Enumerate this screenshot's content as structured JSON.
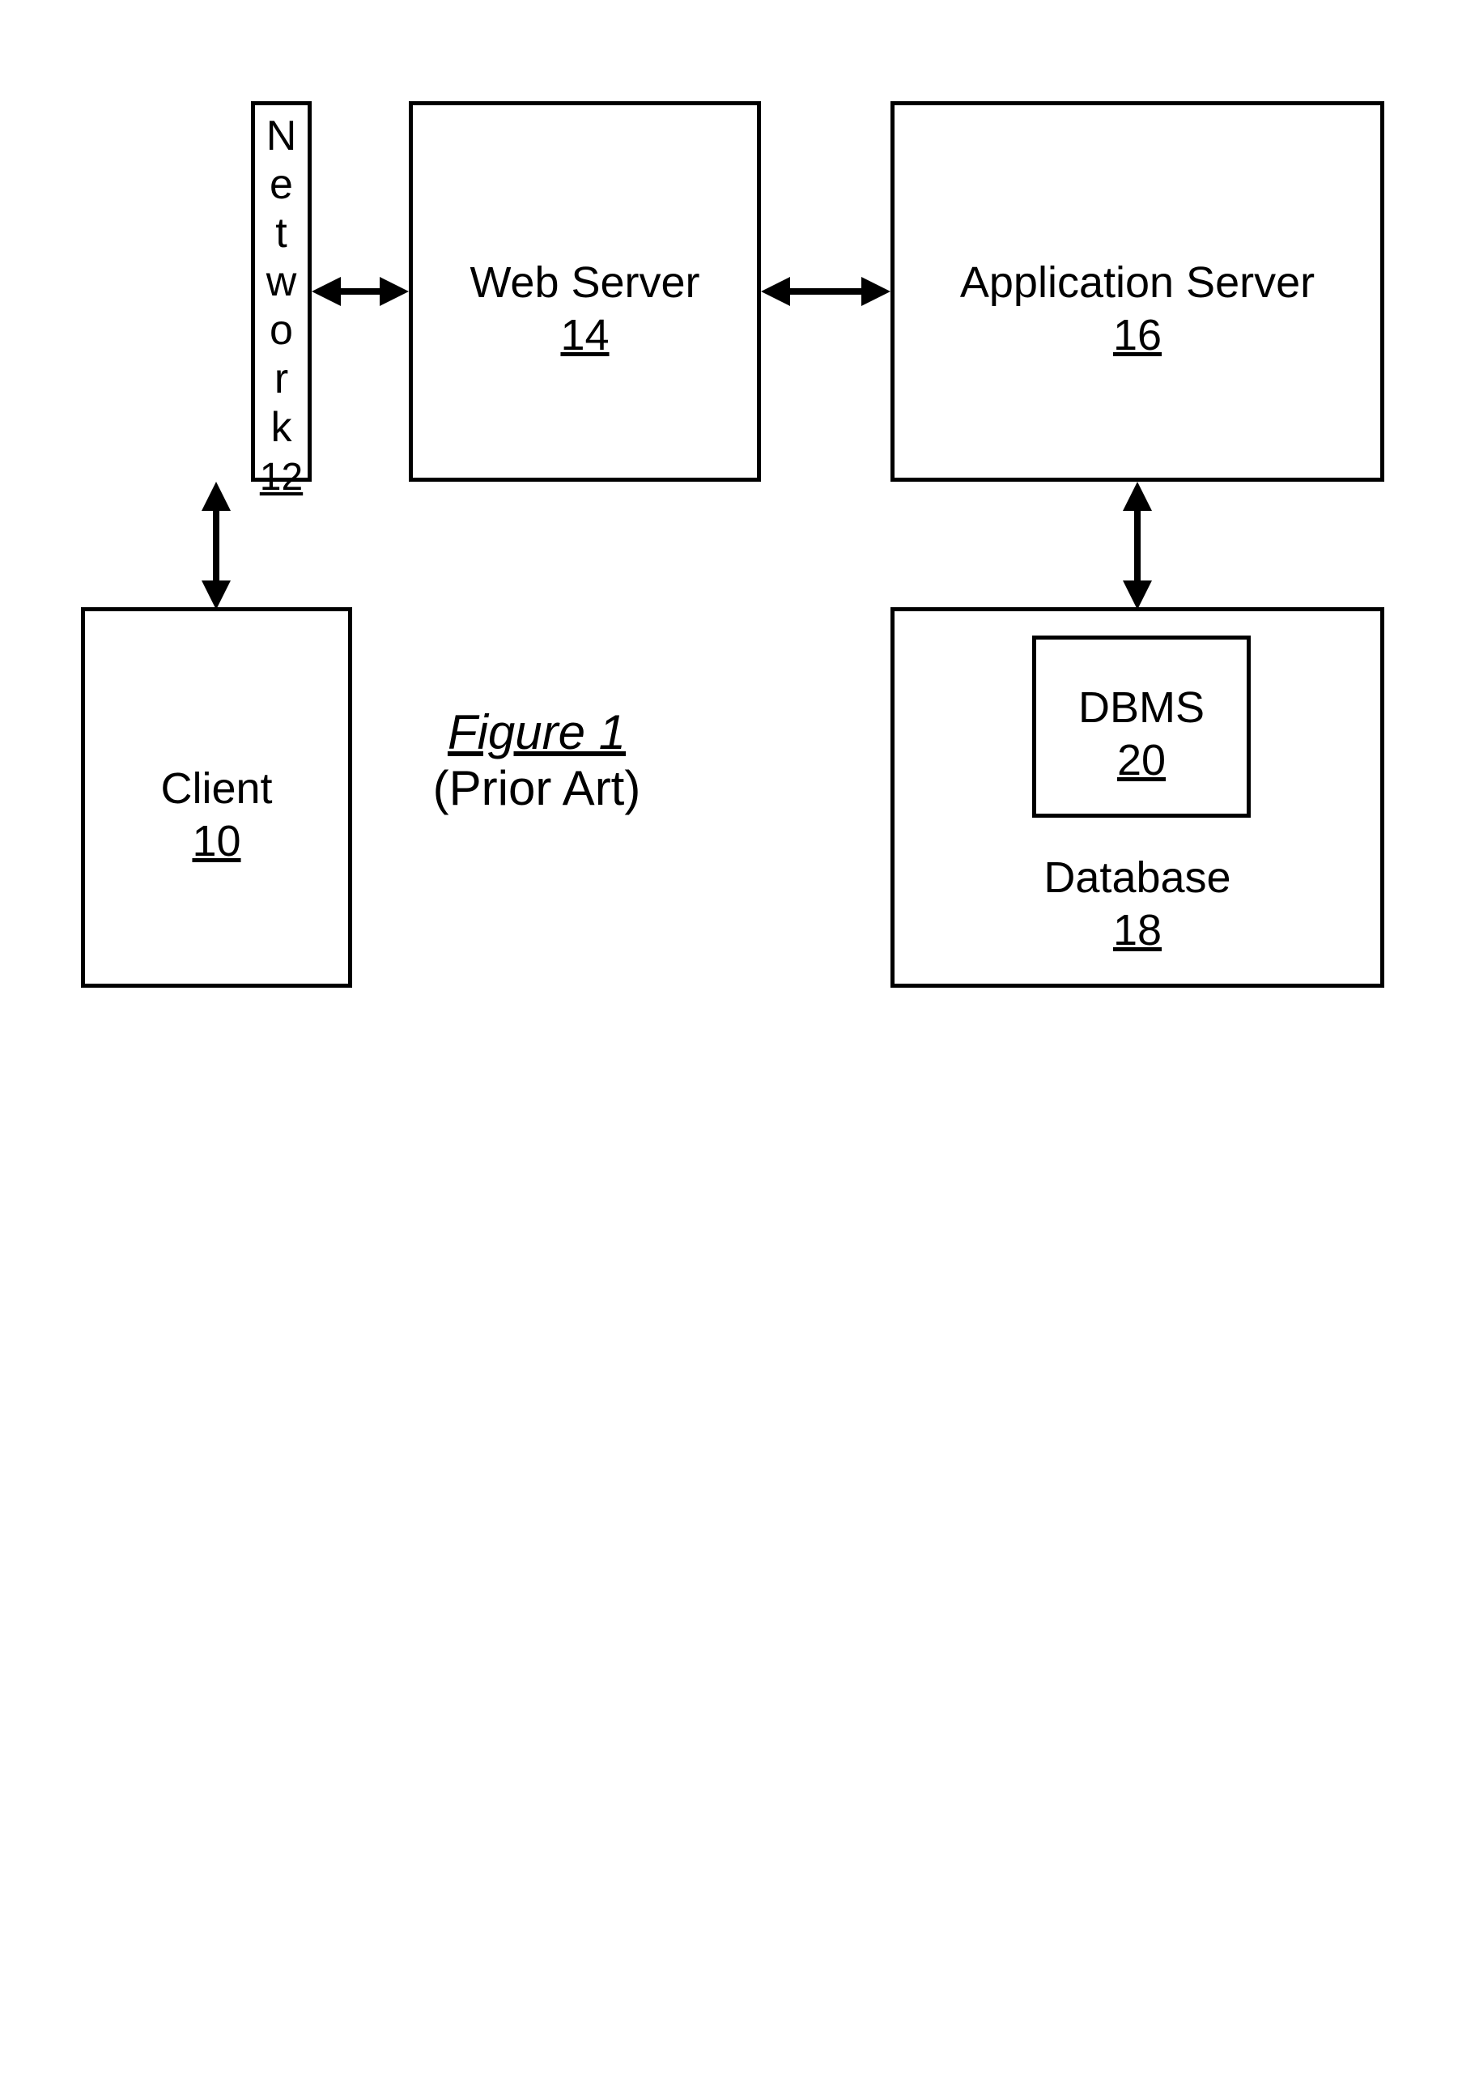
{
  "diagram": {
    "client": {
      "label": "Client",
      "num": "10"
    },
    "network": {
      "label": "Network",
      "num": "12"
    },
    "webserver": {
      "label": "Web Server",
      "num": "14"
    },
    "appserver": {
      "label": "Application Server",
      "num": "16"
    },
    "database": {
      "label": "Database",
      "num": "18"
    },
    "dbms": {
      "label": "DBMS",
      "num": "20"
    }
  },
  "caption": {
    "figure": "Figure 1",
    "subtitle": "(Prior Art)"
  }
}
